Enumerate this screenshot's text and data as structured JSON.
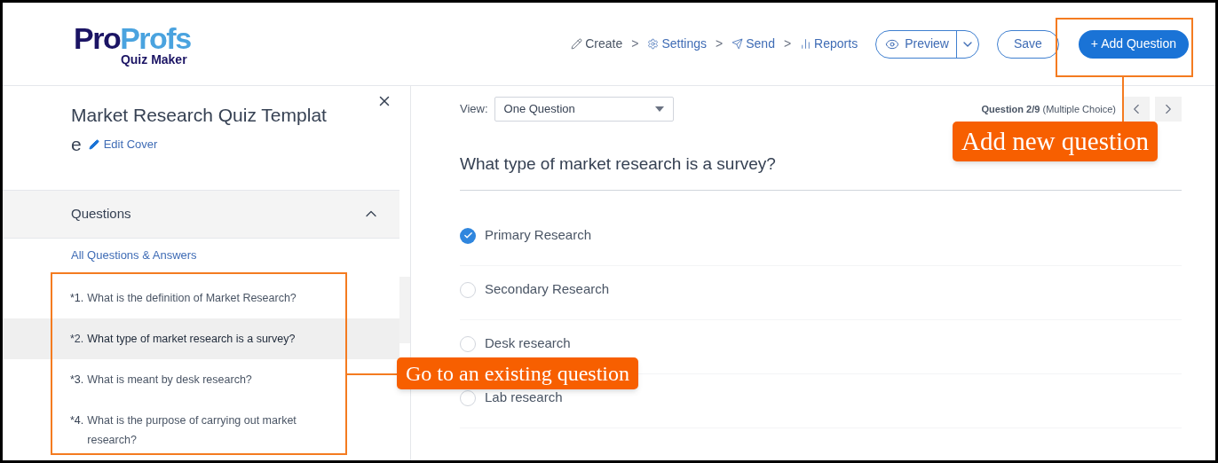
{
  "logo": {
    "part_1": "Pro",
    "part_2": "Profs",
    "subtitle": "Quiz Maker"
  },
  "steps": [
    {
      "kind": "pencil",
      "label": "Create"
    },
    {
      "kind": "gear",
      "label": "Settings"
    },
    {
      "kind": "send",
      "label": "Send"
    },
    {
      "kind": "bars",
      "label": "Reports"
    }
  ],
  "step_separator": ">",
  "actions": {
    "preview": "Preview",
    "save": "Save",
    "add": "+ Add Question"
  },
  "sidebar": {
    "title_line_1": "Market Research Quiz Templat",
    "title_line_2": "e",
    "edit_cover": "Edit Cover",
    "section": "Questions",
    "expanded": true,
    "all_link": "All Questions & Answers",
    "questions": [
      {
        "number": "*1.",
        "text": "What is the definition of Market Research?",
        "selected": false
      },
      {
        "number": "*2.",
        "text": "What type of market research is a survey?",
        "selected": true
      },
      {
        "number": "*3.",
        "text": "What is meant by desk research?",
        "selected": false
      },
      {
        "number": "*4.",
        "text": "What is the purpose of carrying out market research?",
        "selected": false
      }
    ]
  },
  "main": {
    "view_label": "View:",
    "view_value": "One Question",
    "counter": "**Question 2/9** (Multiple Choice)",
    "question": "What type of market research is a survey?",
    "options": [
      {
        "text": "Primary Research",
        "selected": true
      },
      {
        "text": "Secondary Research",
        "selected": false
      },
      {
        "text": "Desk research",
        "selected": false
      },
      {
        "text": "Lab research",
        "selected": false
      }
    ]
  },
  "annotations": [
    {
      "kind": "add",
      "text": "Add new question"
    },
    {
      "kind": "existing",
      "text": "Go to an existing question"
    }
  ]
}
